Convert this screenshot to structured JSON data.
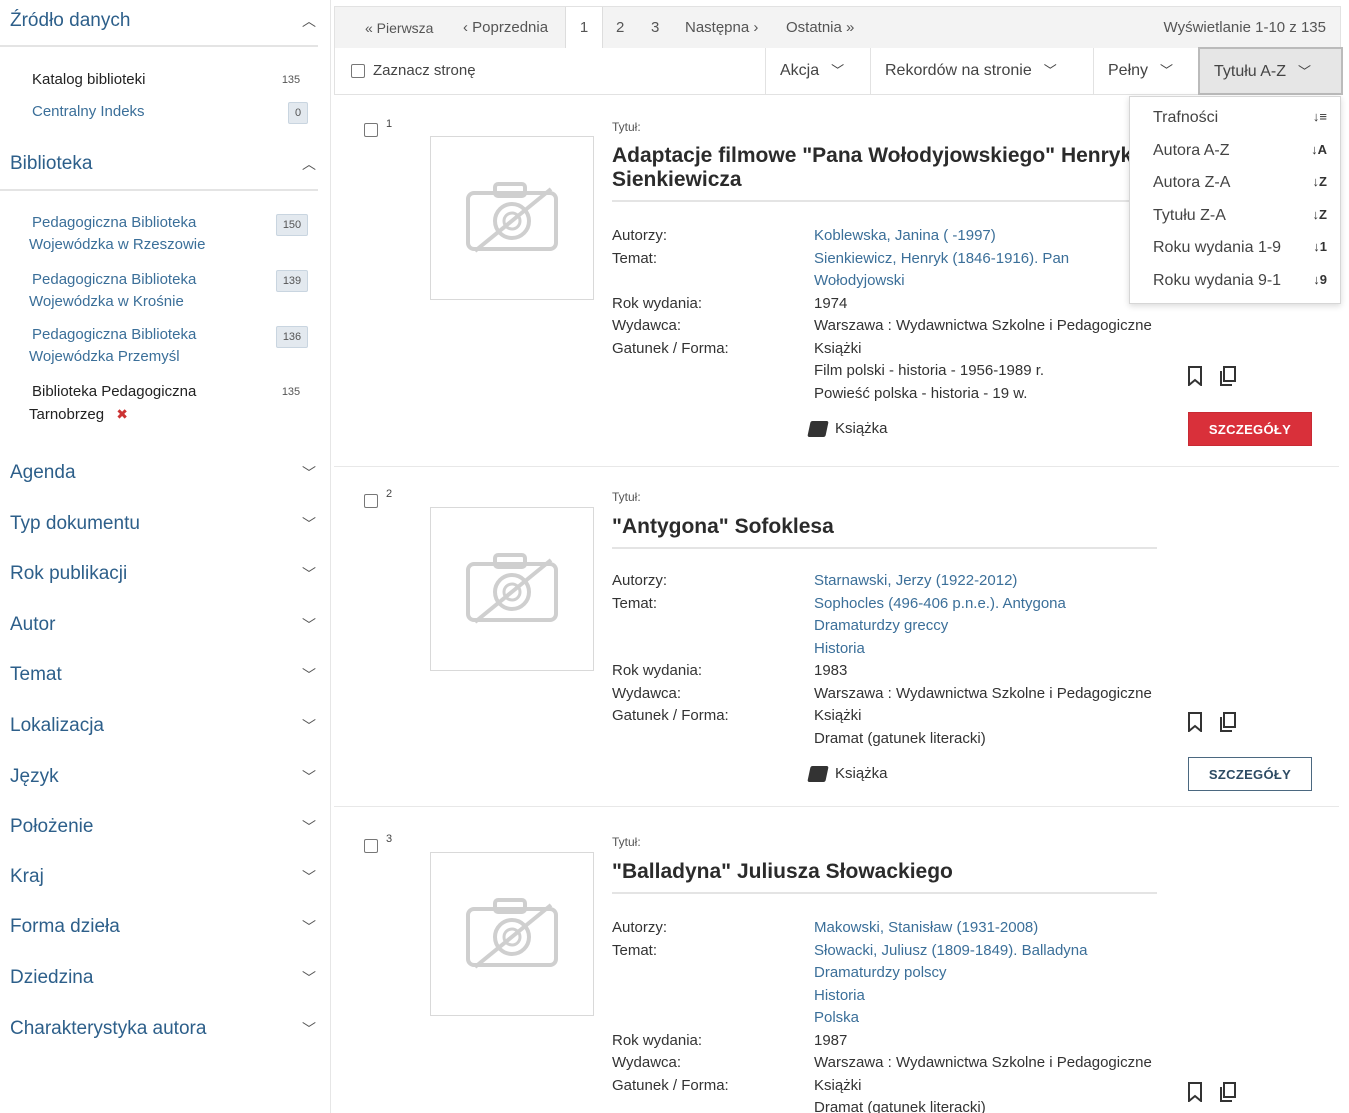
{
  "sidebar": {
    "source": {
      "title": "Źródło danych",
      "items": [
        {
          "label": "Katalog biblioteki",
          "count": "135"
        },
        {
          "label": "Centralny Indeks",
          "count": "0"
        }
      ]
    },
    "library": {
      "title": "Biblioteka",
      "items": [
        {
          "label1": "Pedagogiczna Biblioteka",
          "label2": "Wojewódzka w Rzeszowie",
          "count": "150"
        },
        {
          "label1": "Pedagogiczna Biblioteka",
          "label2": "Wojewódzka w Krośnie",
          "count": "139"
        },
        {
          "label1": "Pedagogiczna Biblioteka",
          "label2": "Wojewódzka Przemyśl",
          "count": "136"
        },
        {
          "label1": "Biblioteka Pedagogiczna",
          "label2": "Tarnobrzeg",
          "count": "135",
          "remove": "✖"
        }
      ]
    },
    "facets": [
      "Agenda",
      "Typ dokumentu",
      "Rok publikacji",
      "Autor",
      "Temat",
      "Lokalizacja",
      "Język",
      "Położenie",
      "Kraj",
      "Forma dzieła",
      "Dziedzina",
      "Charakterystyka autora"
    ]
  },
  "pager": {
    "first": "« Pierwsza",
    "prev": "‹ Poprzednia",
    "pages": [
      "1",
      "2",
      "3"
    ],
    "next": "Następna ›",
    "last": "Ostatnia »",
    "showing": "Wyświetlanie 1-10 z 135"
  },
  "toolbar": {
    "select_page": "Zaznacz stronę",
    "action": "Akcja",
    "per_page": "Rekordów na stronie",
    "view": "Pełny",
    "sort": "Tytułu A-Z"
  },
  "sort_menu": [
    {
      "label": "Trafności",
      "icon": "↓≡"
    },
    {
      "label": "Autora A-Z",
      "icon": "↓A"
    },
    {
      "label": "Autora Z-A",
      "icon": "↓Z"
    },
    {
      "label": "Tytułu Z-A",
      "icon": "↓Z"
    },
    {
      "label": "Roku wydania 1-9",
      "icon": "↓1"
    },
    {
      "label": "Roku wydania 9-1",
      "icon": "↓9"
    }
  ],
  "labels": {
    "title": "Tytuł:",
    "authors": "Autorzy:",
    "subject": "Temat:",
    "year": "Rok wydania:",
    "publisher": "Wydawca:",
    "genre": "Gatunek / Forma:",
    "details": "SZCZEGÓŁY"
  },
  "records": [
    {
      "num": "1",
      "title1": "Adaptacje filmowe \"Pana Wołodyjowskiego\" Henryka",
      "title2": "Sienkiewicza",
      "authors": "Koblewska, Janina ( -1997)",
      "subjects": [
        "Sienkiewicz, Henryk (1846-1916). Pan",
        "Wołodyjowski"
      ],
      "year": "1974",
      "publisher": "Warszawa : Wydawnictwa Szkolne i Pedagogiczne",
      "genres": [
        "Książki",
        "Film polski - historia - 1956-1989 r.",
        "Powieść polska - historia - 19 w."
      ],
      "format": "Książka"
    },
    {
      "num": "2",
      "title1": "\"Antygona\" Sofoklesa",
      "authors": "Starnawski, Jerzy (1922-2012)",
      "subjects": [
        "Sophocles (496-406 p.n.e.). Antygona",
        "Dramaturdzy greccy",
        "Historia"
      ],
      "year": "1983",
      "publisher": "Warszawa : Wydawnictwa Szkolne i Pedagogiczne",
      "genres": [
        "Książki",
        "Dramat (gatunek literacki)"
      ],
      "format": "Książka"
    },
    {
      "num": "3",
      "title1": "\"Balladyna\" Juliusza Słowackiego",
      "authors": "Makowski, Stanisław (1931-2008)",
      "subjects": [
        "Słowacki, Juliusz (1809-1849). Balladyna",
        "Dramaturdzy polscy",
        "Historia",
        "Polska"
      ],
      "year": "1987",
      "publisher": "Warszawa : Wydawnictwa Szkolne i Pedagogiczne",
      "genres": [
        "Książki",
        "Dramat (gatunek literacki)"
      ]
    }
  ]
}
